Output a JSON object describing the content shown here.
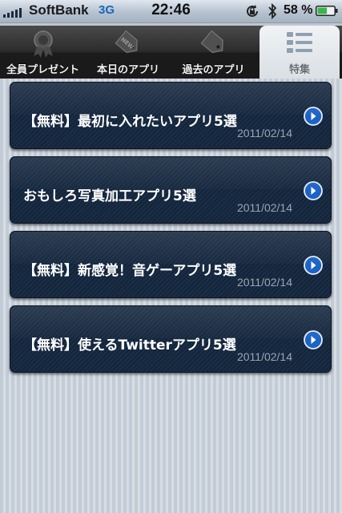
{
  "status_bar": {
    "carrier": "SoftBank",
    "network": "3G",
    "time": "22:46",
    "battery_percent": "58 %",
    "battery_level": 0.58,
    "icons": [
      "signal-bars-icon",
      "rotation-lock-icon",
      "bluetooth-icon",
      "battery-icon"
    ]
  },
  "tabs": [
    {
      "label": "全員プレゼント",
      "icon": "ribbon-award-icon",
      "active": false
    },
    {
      "label": "本日のアプリ",
      "icon": "new-tag-icon",
      "active": false
    },
    {
      "label": "過去のアプリ",
      "icon": "tag-icon",
      "active": false
    },
    {
      "label": "特集",
      "icon": "list-icon",
      "active": true
    }
  ],
  "features": [
    {
      "title": "【無料】最初に入れたいアプリ5選",
      "date": "2011/02/14"
    },
    {
      "title": "おもしろ写真加工アプリ5選",
      "date": "2011/02/14"
    },
    {
      "title": "【無料】新感覚！音ゲーアプリ5選",
      "date": "2011/02/14"
    },
    {
      "title": "【無料】使えるTwitterアプリ5選",
      "date": "2011/02/14"
    }
  ],
  "colors": {
    "accent_blue": "#1c63c8",
    "card_bg": "#172a42",
    "date_text": "#9aa6b4"
  }
}
